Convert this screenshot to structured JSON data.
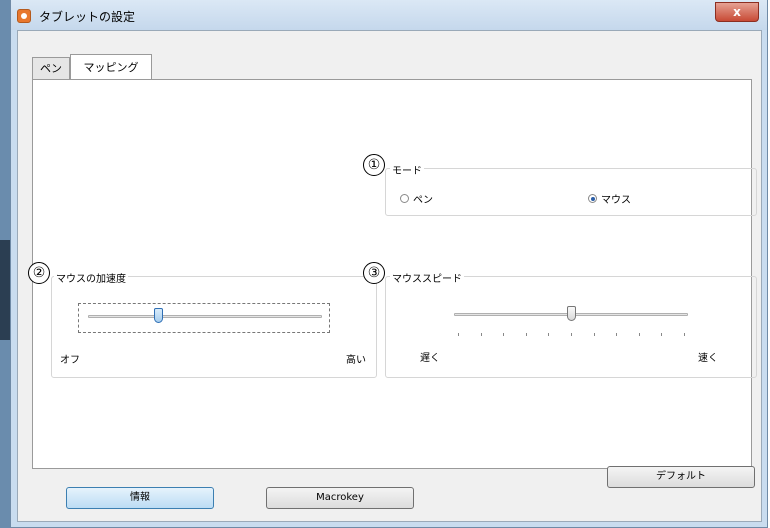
{
  "window": {
    "title": "タブレットの設定",
    "close_label": "x"
  },
  "tabs": [
    {
      "label": "ペン"
    },
    {
      "label": "マッピング"
    }
  ],
  "mode_group": {
    "number": "①",
    "title": "モード",
    "options": [
      {
        "label": "ペン",
        "selected": false
      },
      {
        "label": "マウス",
        "selected": true
      }
    ]
  },
  "accel_group": {
    "number": "②",
    "title": "マウスの加速度",
    "min_label": "オフ",
    "max_label": "高い",
    "level": 0.3
  },
  "speed_group": {
    "number": "③",
    "title": "マウススピード",
    "min_label": "遅く",
    "max_label": "速く",
    "level": 0.5
  },
  "buttons": {
    "default": "デフォルト",
    "info": "情報",
    "macrokey": "Macrokey"
  }
}
